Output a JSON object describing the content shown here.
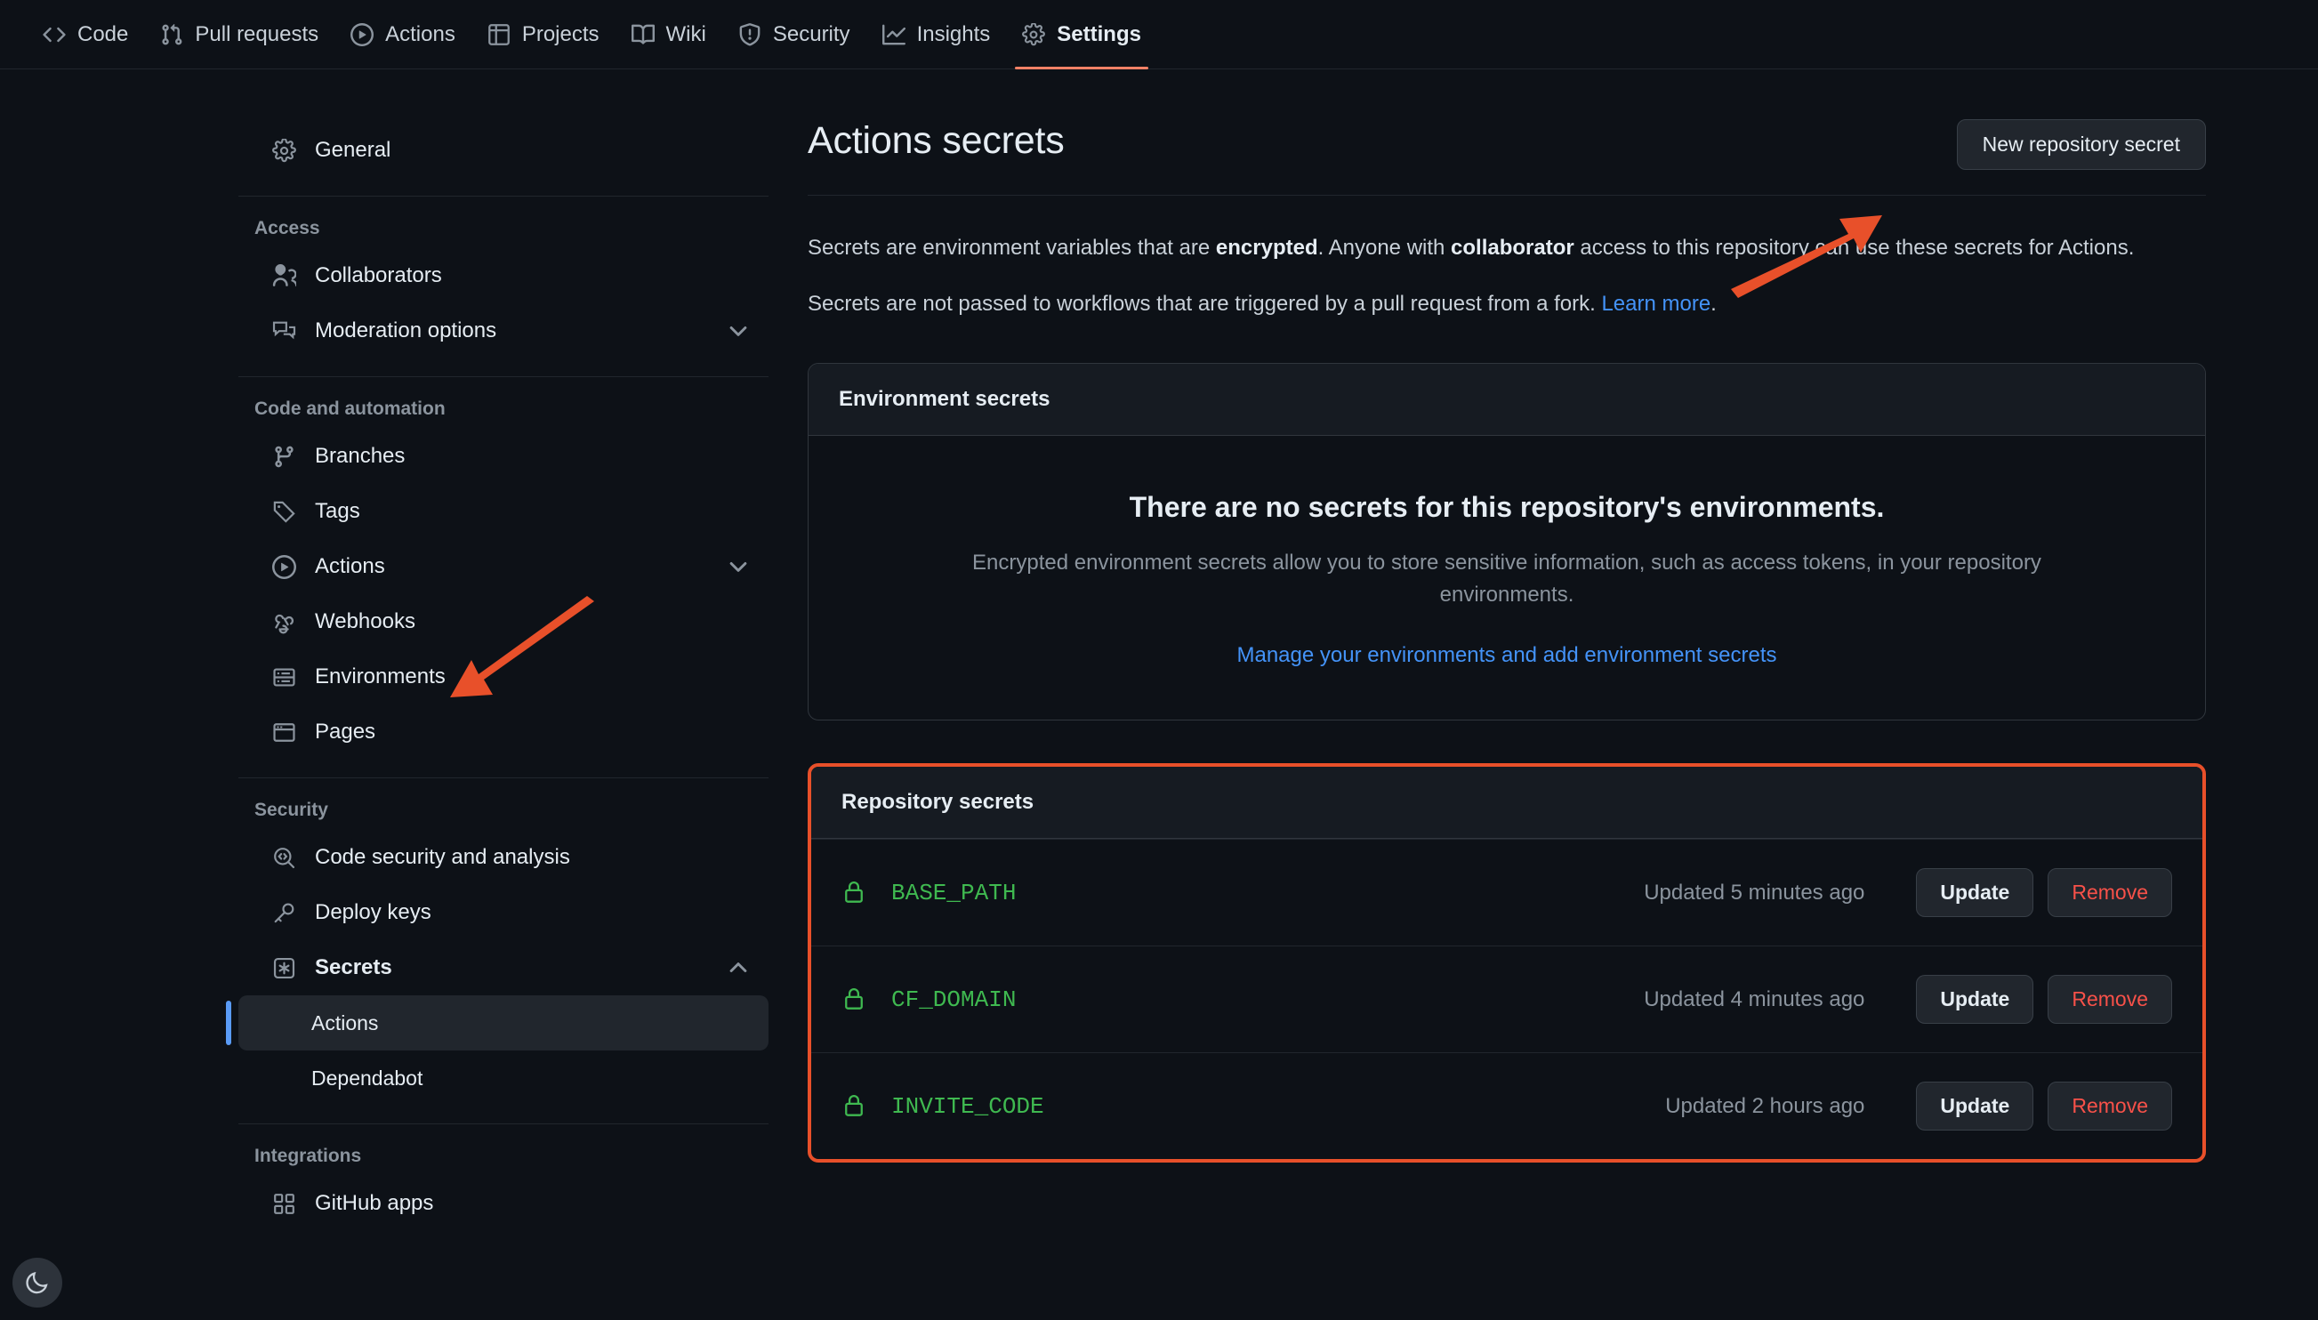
{
  "repo_nav": {
    "items": [
      {
        "label": "Code",
        "icon": "code-icon",
        "active": false
      },
      {
        "label": "Pull requests",
        "icon": "git-pull-request-icon",
        "active": false
      },
      {
        "label": "Actions",
        "icon": "play-circle-icon",
        "active": false
      },
      {
        "label": "Projects",
        "icon": "table-icon",
        "active": false
      },
      {
        "label": "Wiki",
        "icon": "book-icon",
        "active": false
      },
      {
        "label": "Security",
        "icon": "shield-icon",
        "active": false
      },
      {
        "label": "Insights",
        "icon": "graph-icon",
        "active": false
      },
      {
        "label": "Settings",
        "icon": "gear-icon",
        "active": true
      }
    ]
  },
  "sidebar": {
    "general": {
      "label": "General",
      "icon": "gear-icon"
    },
    "groups": [
      {
        "heading": "Access",
        "items": [
          {
            "label": "Collaborators",
            "icon": "people-icon",
            "chevron": ""
          },
          {
            "label": "Moderation options",
            "icon": "comment-discussion-icon",
            "chevron": "chevron-down-icon"
          }
        ]
      },
      {
        "heading": "Code and automation",
        "items": [
          {
            "label": "Branches",
            "icon": "git-branch-icon",
            "chevron": ""
          },
          {
            "label": "Tags",
            "icon": "tag-icon",
            "chevron": ""
          },
          {
            "label": "Actions",
            "icon": "play-circle-icon",
            "chevron": "chevron-down-icon"
          },
          {
            "label": "Webhooks",
            "icon": "webhook-icon",
            "chevron": ""
          },
          {
            "label": "Environments",
            "icon": "server-icon",
            "chevron": ""
          },
          {
            "label": "Pages",
            "icon": "browser-icon",
            "chevron": ""
          }
        ]
      },
      {
        "heading": "Security",
        "items": [
          {
            "label": "Code security and analysis",
            "icon": "code-scan-icon",
            "chevron": ""
          },
          {
            "label": "Deploy keys",
            "icon": "key-icon",
            "chevron": ""
          },
          {
            "label": "Secrets",
            "icon": "asterisk-box-icon",
            "chevron": "chevron-up-icon",
            "bold": true
          }
        ],
        "subitems": [
          {
            "label": "Actions",
            "selected": true
          },
          {
            "label": "Dependabot",
            "selected": false
          }
        ]
      },
      {
        "heading": "Integrations",
        "items": [
          {
            "label": "GitHub apps",
            "icon": "apps-grid-icon",
            "chevron": ""
          }
        ]
      }
    ]
  },
  "main": {
    "title": "Actions secrets",
    "new_secret_button": "New repository secret",
    "blurb": {
      "part1": "Secrets are environment variables that are ",
      "bold1": "encrypted",
      "part2": ". Anyone with ",
      "bold2": "collaborator",
      "part3": " access to this repository can use these secrets for Actions."
    },
    "blurb2": {
      "text": "Secrets are not passed to workflows that are triggered by a pull request from a fork. ",
      "link": "Learn more",
      "tail": "."
    },
    "environment_panel": {
      "header": "Environment secrets",
      "empty_title": "There are no secrets for this repository's environments.",
      "empty_desc": "Encrypted environment secrets allow you to store sensitive information, such as access tokens, in your repository environments.",
      "empty_link": "Manage your environments and add environment secrets"
    },
    "repository_panel": {
      "header": "Repository secrets",
      "column_action_update": "Update",
      "column_action_remove": "Remove",
      "rows": [
        {
          "name": "BASE_PATH",
          "updated": "Updated 5 minutes ago",
          "update": "Update",
          "remove": "Remove",
          "icon": "lock-icon"
        },
        {
          "name": "CF_DOMAIN",
          "updated": "Updated 4 minutes ago",
          "update": "Update",
          "remove": "Remove",
          "icon": "lock-icon"
        },
        {
          "name": "INVITE_CODE",
          "updated": "Updated 2 hours ago",
          "update": "Update",
          "remove": "Remove",
          "icon": "lock-icon"
        }
      ]
    }
  },
  "theme_toggle": {
    "icon": "moon-icon"
  },
  "colors": {
    "background": "#0d1117",
    "panel_header": "#161b22",
    "border": "#30363d",
    "text": "#e6edf3",
    "muted": "#8b949e",
    "link": "#4493f8",
    "secret_green": "#3fb950",
    "danger_red": "#f85149",
    "annotation_orange": "#e8502a",
    "active_tab_underline": "#f78166",
    "selected_marker_blue": "#5a9bf6"
  }
}
